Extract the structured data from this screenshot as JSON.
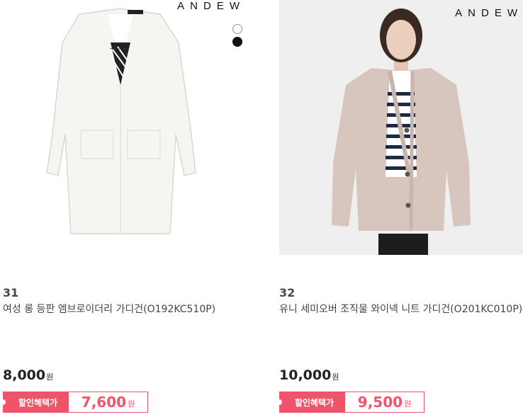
{
  "products": [
    {
      "brand": "ANDEW",
      "rank": "31",
      "name": "여성 롱 등판 엠브로이더리 가디건(O192KC510P)",
      "price": "8,000",
      "price_unit": "원",
      "discount_label": "할인혜택가",
      "discount_price": "7,600",
      "discount_unit": "원",
      "swatches": [
        "white",
        "black"
      ]
    },
    {
      "brand": "ANDEW",
      "rank": "32",
      "name": "유니 세미오버 조직물 와이넥 니트 가디건(O201KC010P)",
      "price": "10,000",
      "price_unit": "원",
      "discount_label": "할인혜택가",
      "discount_price": "9,500",
      "discount_unit": "원"
    }
  ],
  "colors": {
    "accent": "#f0546a",
    "text": "#333333"
  }
}
